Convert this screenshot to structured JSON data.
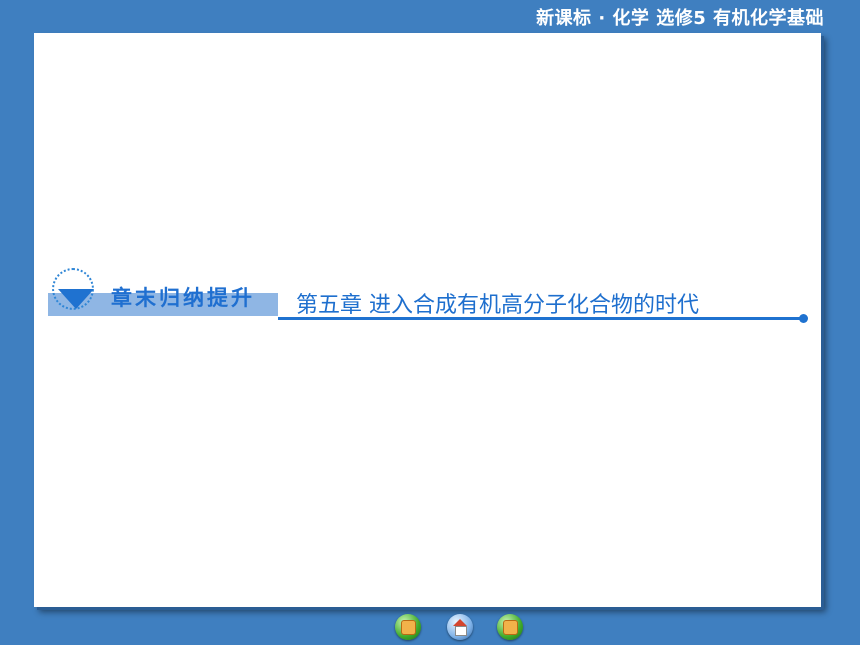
{
  "header": {
    "text": "新课标 · 化学  选修5  有机化学基础"
  },
  "title": {
    "badge_label": "章末归纳提升",
    "chapter_label": "第五章  进入合成有机高分子化合物的时代"
  },
  "nav": {
    "prev_icon": "prev-arrow-icon",
    "home_icon": "home-icon",
    "next_icon": "next-arrow-icon"
  },
  "colors": {
    "background": "#3f7fc0",
    "accent": "#1f72d0",
    "badge_bar": "#8fb6e4"
  }
}
